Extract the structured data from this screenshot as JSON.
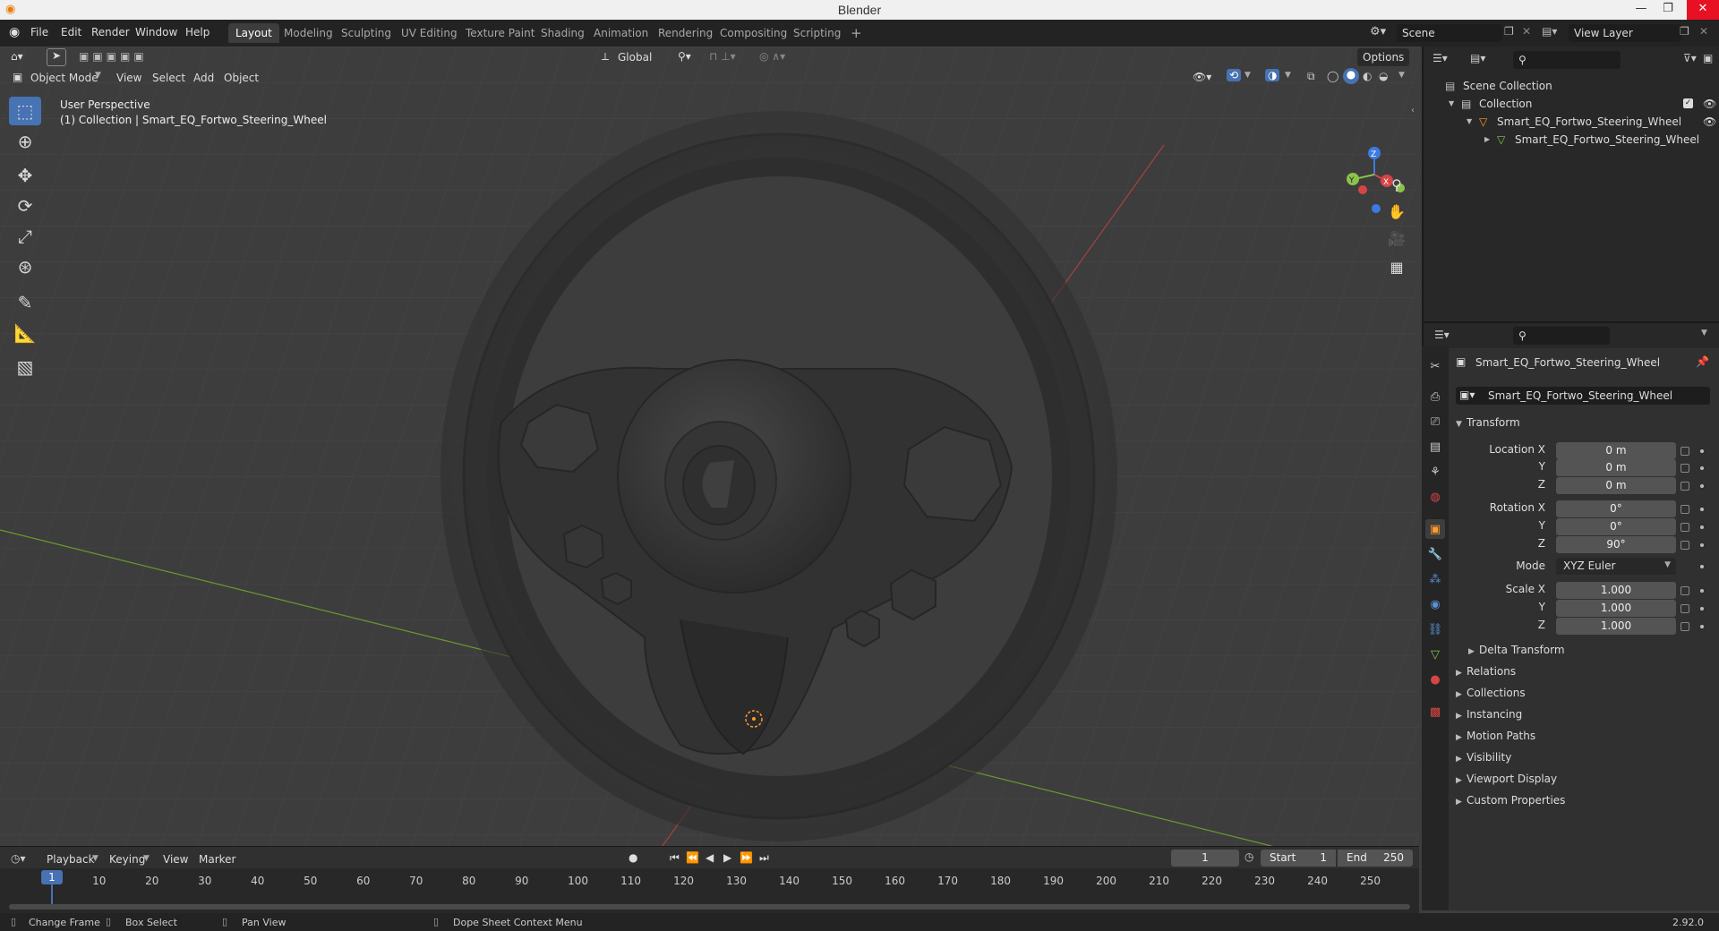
{
  "window": {
    "title": "Blender"
  },
  "menu": [
    "File",
    "Edit",
    "Render",
    "Window",
    "Help"
  ],
  "workspaces": [
    "Layout",
    "Modeling",
    "Sculpting",
    "UV Editing",
    "Texture Paint",
    "Shading",
    "Animation",
    "Rendering",
    "Compositing",
    "Scripting"
  ],
  "workspace_add": "+",
  "scene": {
    "name": "Scene",
    "view_layer": "View Layer"
  },
  "viewport_header": {
    "mode": "Object Mode",
    "menus": [
      "View",
      "Select",
      "Add",
      "Object"
    ],
    "orientation": "Global",
    "options": "Options"
  },
  "viewport": {
    "perspective": "User Perspective",
    "collection_info": "(1) Collection | Smart_EQ_Fortwo_Steering_Wheel",
    "gizmo": {
      "x": "X",
      "y": "Y",
      "z": "Z"
    }
  },
  "outliner": {
    "scene_collection": "Scene Collection",
    "collection": "Collection",
    "object": "Smart_EQ_Fortwo_Steering_Wheel",
    "mesh": "Smart_EQ_Fortwo_Steering_Wheel"
  },
  "properties": {
    "object_name": "Smart_EQ_Fortwo_Steering_Wheel",
    "data_name": "Smart_EQ_Fortwo_Steering_Wheel",
    "transform": {
      "title": "Transform",
      "location_label": "Location X",
      "location": [
        "0 m",
        "0 m",
        "0 m"
      ],
      "rotation_label": "Rotation X",
      "rotation": [
        "0°",
        "0°",
        "90°"
      ],
      "mode_label": "Mode",
      "mode": "XYZ Euler",
      "scale_label": "Scale X",
      "scale": [
        "1.000",
        "1.000",
        "1.000"
      ],
      "y": "Y",
      "z": "Z"
    },
    "sections": [
      "Delta Transform",
      "Relations",
      "Collections",
      "Instancing",
      "Motion Paths",
      "Visibility",
      "Viewport Display",
      "Custom Properties"
    ]
  },
  "timeline": {
    "menus": [
      "Playback",
      "Keying",
      "View",
      "Marker"
    ],
    "current_frame": "1",
    "start_label": "Start",
    "start": "1",
    "end_label": "End",
    "end": "250",
    "ticks": [
      "1",
      "10",
      "20",
      "30",
      "40",
      "50",
      "60",
      "70",
      "80",
      "90",
      "100",
      "110",
      "120",
      "130",
      "140",
      "150",
      "160",
      "170",
      "180",
      "190",
      "200",
      "210",
      "220",
      "230",
      "240",
      "250"
    ]
  },
  "status": {
    "change_frame": "Change Frame",
    "box_select": "Box Select",
    "pan_view": "Pan View",
    "context_menu": "Dope Sheet Context Menu",
    "version": "2.92.0"
  },
  "colors": {
    "accent": "#4772b3",
    "x_axis": "#d64545",
    "y_axis": "#8bc34a",
    "z_axis": "#3d7ae0",
    "active_object": "#ff9a2b"
  }
}
